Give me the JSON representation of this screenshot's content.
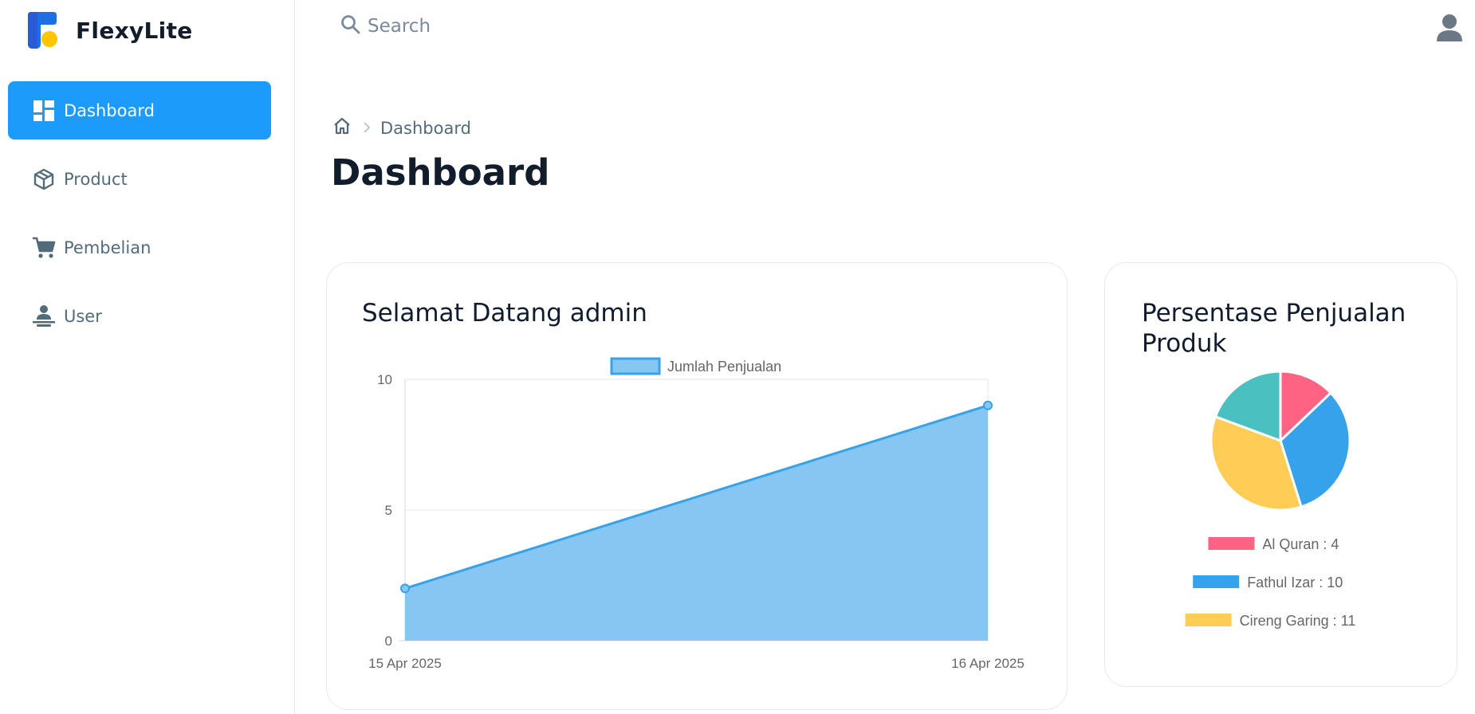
{
  "app": {
    "name": "FlexyLite"
  },
  "sidebar": {
    "items": [
      {
        "label": "Dashboard",
        "icon": "dashboard-icon",
        "active": true
      },
      {
        "label": "Product",
        "icon": "box-icon",
        "active": false
      },
      {
        "label": "Pembelian",
        "icon": "cart-icon",
        "active": false
      },
      {
        "label": "User",
        "icon": "user-icon",
        "active": false
      }
    ]
  },
  "header": {
    "search_placeholder": "Search"
  },
  "breadcrumb": {
    "current": "Dashboard"
  },
  "page": {
    "title": "Dashboard"
  },
  "colors": {
    "accent": "#1d9bfb",
    "area_fill": "#87c6f2",
    "area_line": "#36a2eb"
  },
  "chart_data": [
    {
      "type": "area",
      "title": "Selamat Datang admin",
      "legend": "top",
      "series": [
        {
          "name": "Jumlah Penjualan",
          "values": [
            2,
            9
          ]
        }
      ],
      "categories": [
        "15 Apr 2025",
        "16 Apr 2025"
      ],
      "ylim": [
        0,
        10
      ],
      "yticks": [
        "10",
        "5",
        "0"
      ],
      "grid": true
    },
    {
      "type": "pie",
      "title": "Persentase Penjualan Produk",
      "legend": "bottom",
      "slices": [
        {
          "label": "Al Quran : 4",
          "value": 4,
          "color": "#ff6384"
        },
        {
          "label": "Fathul Izar : 10",
          "value": 10,
          "color": "#36a2eb"
        },
        {
          "label": "Cireng Garing : 11",
          "value": 11,
          "color": "#ffcd56"
        },
        {
          "label": "",
          "value": 6,
          "color": "#4bc0c0"
        }
      ]
    }
  ]
}
